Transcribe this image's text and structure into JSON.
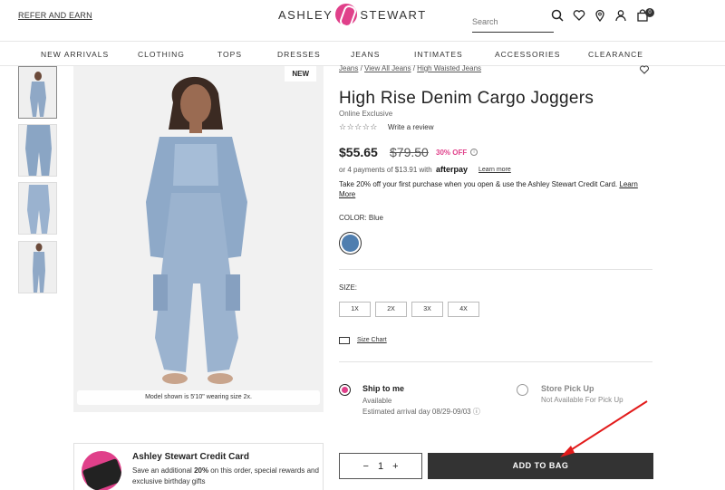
{
  "header": {
    "refer_link": "REFER AND EARN",
    "logo_left": "ASHLEY",
    "logo_right": "STEWART",
    "search_placeholder": "Search",
    "cart_count": "0"
  },
  "nav": {
    "items": [
      "NEW ARRIVALS",
      "CLOTHING",
      "TOPS",
      "DRESSES",
      "JEANS",
      "INTIMATES",
      "ACCESSORIES",
      "CLEARANCE"
    ]
  },
  "gallery": {
    "new_badge": "NEW",
    "model_note": "Model shown is 5'10\" wearing size 2x."
  },
  "credit_card": {
    "title": "Ashley Stewart Credit Card",
    "text_prefix": "Save an additional ",
    "text_bold": "20%",
    "text_suffix": " on this order, special rewards and exclusive birthday gifts"
  },
  "product": {
    "breadcrumb": [
      "Jeans",
      "View All Jeans",
      "High Waisted Jeans"
    ],
    "title": "High Rise Denim Cargo Joggers",
    "exclusive": "Online Exclusive",
    "stars": "☆☆☆☆☆",
    "write_review": "Write a review",
    "price": "$55.65",
    "original_price": "$79.50",
    "discount": "30% OFF",
    "payments_text": "or 4 payments of $13.91 with",
    "afterpay": "afterpay",
    "learn_more": "Learn more",
    "promo_text": "Take 20% off your first purchase when you open & use the Ashley Stewart Credit Card.",
    "promo_link": "Learn More",
    "color_label": "COLOR:",
    "color_value": "Blue",
    "swatch_color": "#4f7eaf",
    "size_label": "SIZE:",
    "sizes": [
      "1X",
      "2X",
      "3X",
      "4X"
    ],
    "size_chart": "Size Chart"
  },
  "fulfillment": {
    "ship_title": "Ship to me",
    "ship_status": "Available",
    "ship_eta": "Estimated arrival day 08/29-09/03",
    "pickup_title": "Store Pick Up",
    "pickup_status": "Not Available For Pick Up"
  },
  "cart": {
    "quantity": "1",
    "minus": "−",
    "plus": "+",
    "add_to_bag": "ADD TO BAG"
  },
  "colors": {
    "accent": "#e0408a",
    "button": "#333333",
    "annotation_arrow": "#e21b1b"
  }
}
